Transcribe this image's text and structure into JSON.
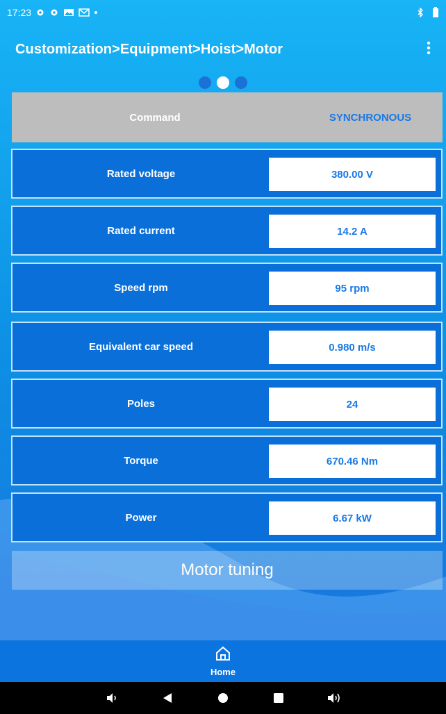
{
  "status_bar": {
    "time": "17:23",
    "left_icons": [
      "gear-icon",
      "gear-icon",
      "photo-icon",
      "gmail-icon",
      "dot-icon"
    ],
    "right_icons": [
      "bluetooth-icon",
      "battery-icon"
    ]
  },
  "app_bar": {
    "title": "Customization>Equipment>Hoist>Motor"
  },
  "pager": {
    "count": 3,
    "active_index": 1
  },
  "command": {
    "label": "Command",
    "value": "SYNCHRONOUS"
  },
  "parameters": [
    {
      "label": "Rated voltage",
      "value": "380.00 V"
    },
    {
      "label": "Rated current",
      "value": "14.2 A"
    },
    {
      "label": "Speed rpm",
      "value": "95 rpm"
    },
    {
      "label": "Equivalent car speed",
      "value": "0.980 m/s"
    },
    {
      "label": "Poles",
      "value": "24"
    },
    {
      "label": "Torque",
      "value": "670.46 Nm"
    },
    {
      "label": "Power",
      "value": "6.67 kW"
    }
  ],
  "motor_tuning_label": "Motor tuning",
  "bottom_nav": {
    "home_label": "Home"
  },
  "system_nav": [
    "volume-down-icon",
    "back-icon",
    "home-circle-icon",
    "recents-icon",
    "volume-up-icon"
  ]
}
